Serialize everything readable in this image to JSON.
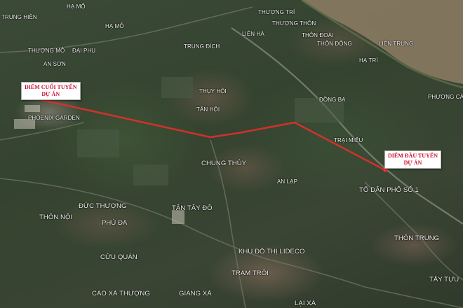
{
  "colors": {
    "route": "#d9302a",
    "callout_text": "#c8102e",
    "river": "#8a7a63",
    "label": "#f2f2ee"
  },
  "callouts": {
    "end": {
      "line1": "DIỂM CUỐI TUYẾN",
      "line2": "DỰ ÁN"
    },
    "start": {
      "line1": "DIỂM ĐẦU TUYẾN",
      "line2": "DỰ ÁN"
    }
  },
  "place_labels": {
    "trung_hien": "TRUNG HIỀN",
    "ha_mo_top": "HẠ MỖ",
    "ha_mo_2": "HẠ MỖ",
    "thuong_mo": "THƯỢNG MỖ",
    "dai_phu": "ĐẠI PHU",
    "an_son": "AN SƠN",
    "trung_dich": "TRUNG ĐÍCH",
    "lien_ha": "LIÊN HÀ",
    "thuong_tri": "THƯỢNG TRÍ",
    "thuong_thon": "THƯỢNG THÔN",
    "thon_doai": "THÔN ĐOÀI",
    "thon_dong": "THÔN ĐÔNG",
    "lien_trung": "LIÊN TRUNG",
    "ha_tri": "HẠ TRÌ",
    "phuong_cac": "PHƯƠNG CÁC",
    "thuy_hoi": "THỤY HỘI",
    "tan_hoi": "TÂN HỘI",
    "dong_ba": "ĐỒNG BA",
    "phoenix_garden": "PHOENIX GARDEN",
    "trai_mieu": "TRẠI MIẾU",
    "chung_thuy": "CHUNG THỦY",
    "an_lap": "AN LẠP",
    "to_dan_pho": "TỔ DÂN PHỐ SỐ 1",
    "duc_thuong": "ĐỨC THƯỢNG",
    "tan_tay_do": "TÂN TÂY ĐÔ",
    "thon_noi": "THÔN NỘI",
    "phu_da": "PHÚ ĐA",
    "khu_do_thi": "KHU ĐÔ THỊ LIDECO",
    "thon_trung": "THÔN TRUNG",
    "cuu_quan": "CỬU QUÁN",
    "tram_troi": "TRẠM TRÔI",
    "tay_tuu": "TÂY TỰU",
    "cao_xa_thuong": "CAO XÁ THƯỢNG",
    "giang_xa": "GIANG XÁ",
    "lai_xa": "LẠI XÁ"
  }
}
